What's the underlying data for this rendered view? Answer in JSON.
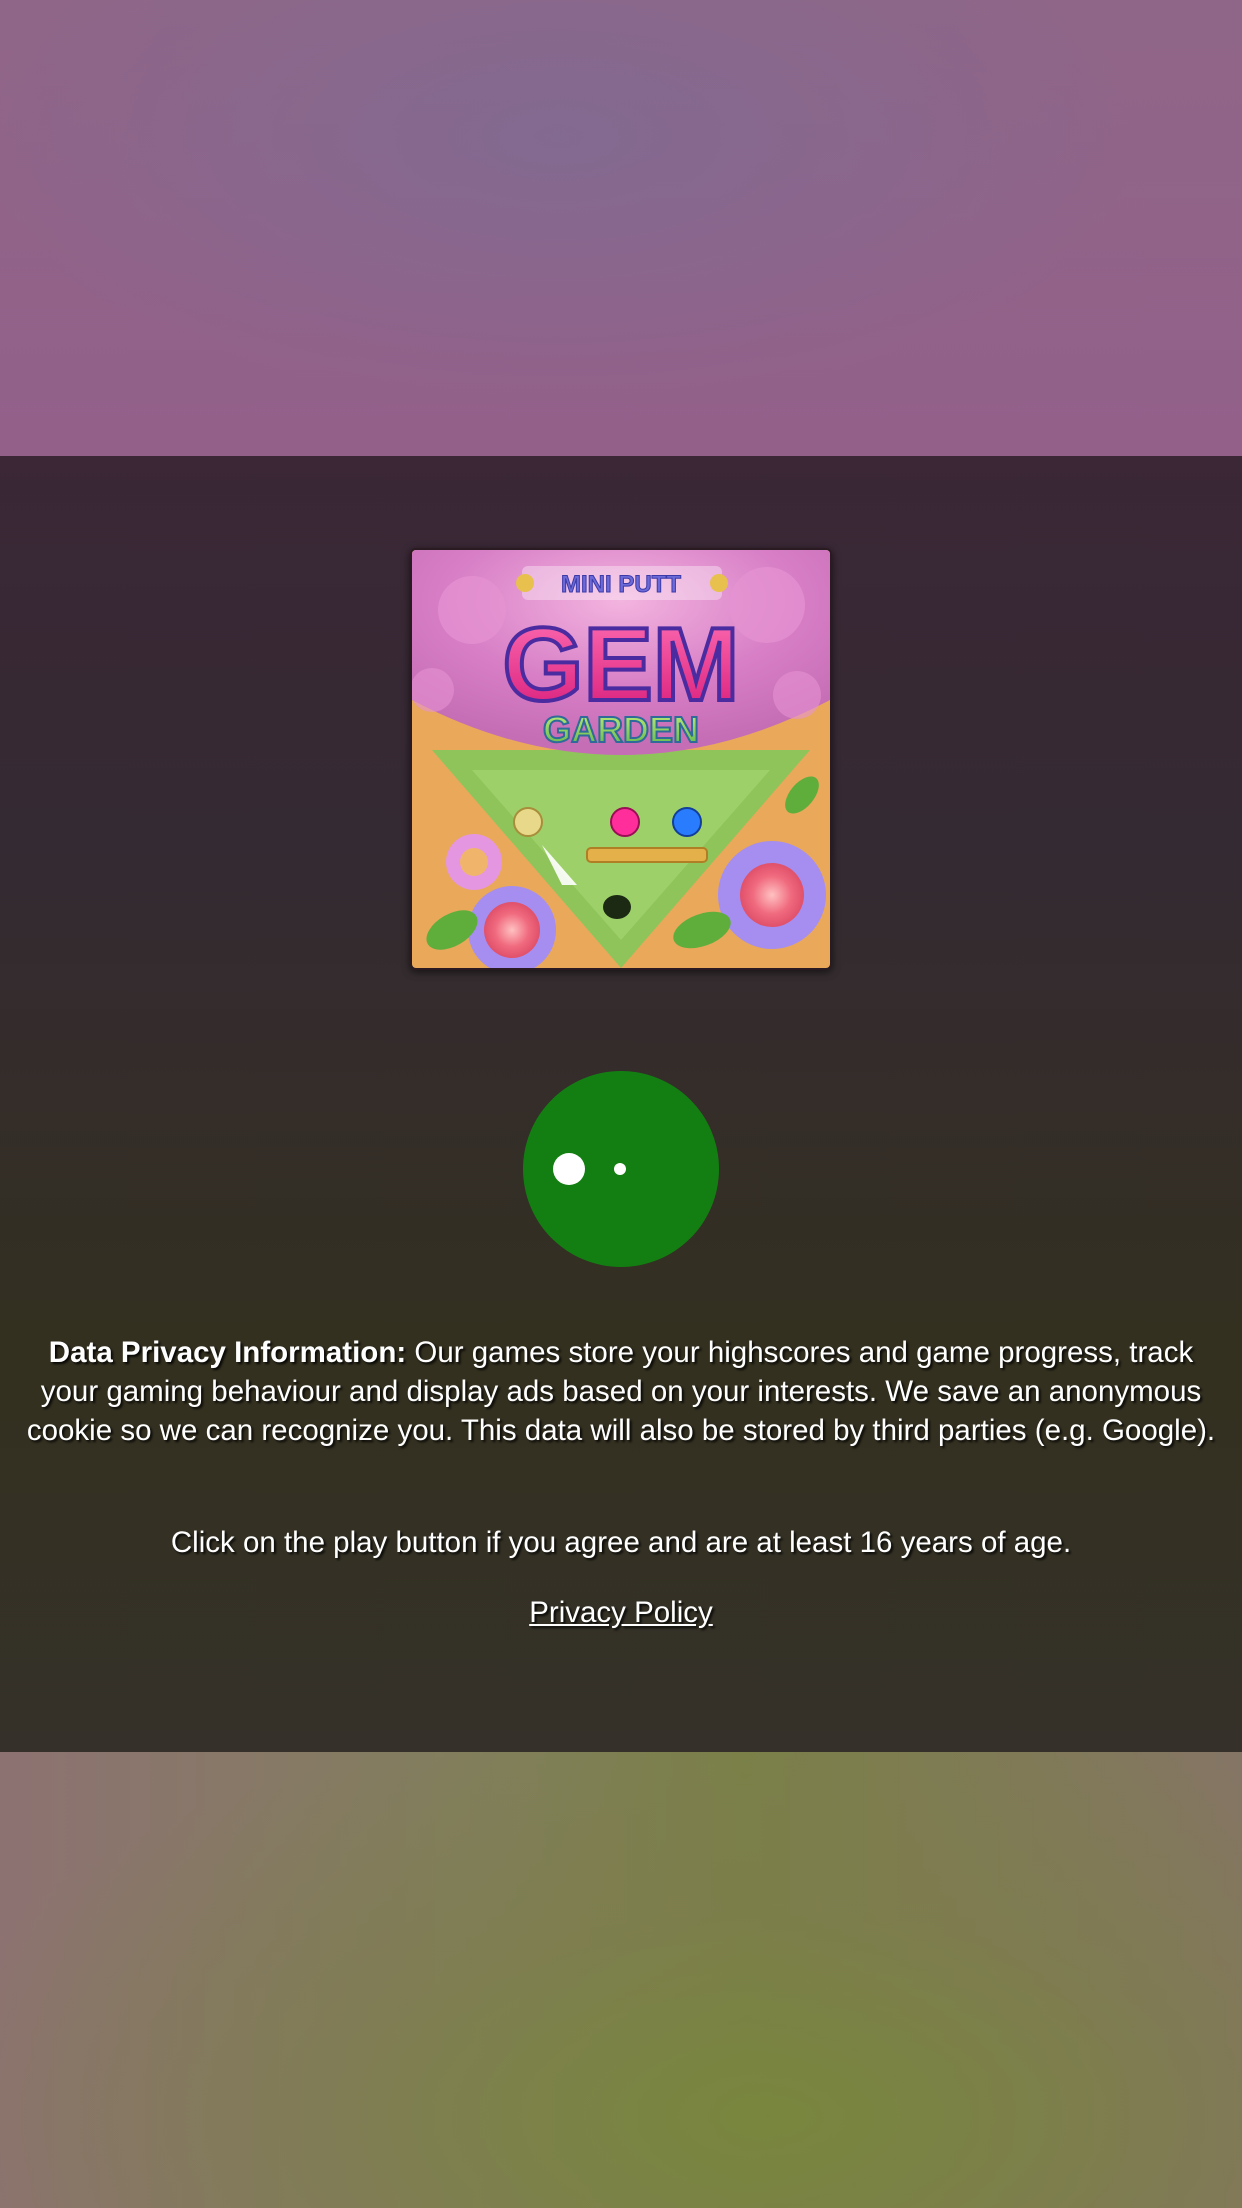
{
  "game": {
    "logo_line1": "MINI PUTT",
    "logo_line2": "GEM",
    "logo_line3": "GARDEN",
    "thumbnail_name": "game-thumbnail"
  },
  "play_button": {
    "icon": "play-loading-dots-icon",
    "color": "#137f12"
  },
  "privacy": {
    "heading": "Data Privacy Information:",
    "body": " Our games store your highscores and game progress, track your gaming behaviour and display ads based on your interests. We save an anonymous cookie so we can recognize you. This data will also be stored by third parties (e.g. Google).",
    "agree_text": "Click on the play button if you agree and are at least 16 years of age.",
    "policy_link": "Privacy Policy"
  },
  "colors": {
    "overlay": "#342a2c",
    "text": "#ffffff",
    "accent_green": "#137f12"
  }
}
